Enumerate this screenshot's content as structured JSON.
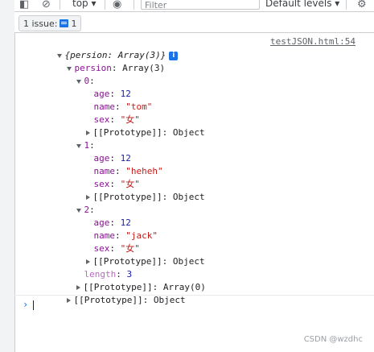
{
  "toolbar": {
    "context_label": "top",
    "filter_placeholder": "Filter",
    "levels_label": "Default levels"
  },
  "issues": {
    "label": "1 issue:",
    "count": "1"
  },
  "console": {
    "source_link": "testJSON.html:54",
    "summary": "{persion: Array(3)}",
    "info_icon": "i",
    "root_key": "persion",
    "root_value": "Array(3)",
    "items": [
      {
        "index": "0",
        "age": "12",
        "name": "\"tom\"",
        "sex": "\"女\""
      },
      {
        "index": "1",
        "age": "12",
        "name": "\"heheh\"",
        "sex": "\"女\""
      },
      {
        "index": "2",
        "age": "12",
        "name": "\"jack\"",
        "sex": "\"女\""
      }
    ],
    "labels": {
      "age": "age",
      "name": "name",
      "sex": "sex",
      "colon": ":"
    },
    "prototype_object": "[[Prototype]]: Object",
    "length_key": "length",
    "length_value": "3",
    "prototype_array": "[[Prototype]]: Array(0)",
    "prototype_root": "[[Prototype]]: Object"
  },
  "watermark": "CSDN @wzdhc",
  "icons": [
    "sidebar-toggle-icon",
    "clear-console-icon",
    "eye-icon",
    "settings-gear-icon",
    "issue-flag-icon",
    "info-icon",
    "prompt-chevron-icon"
  ]
}
